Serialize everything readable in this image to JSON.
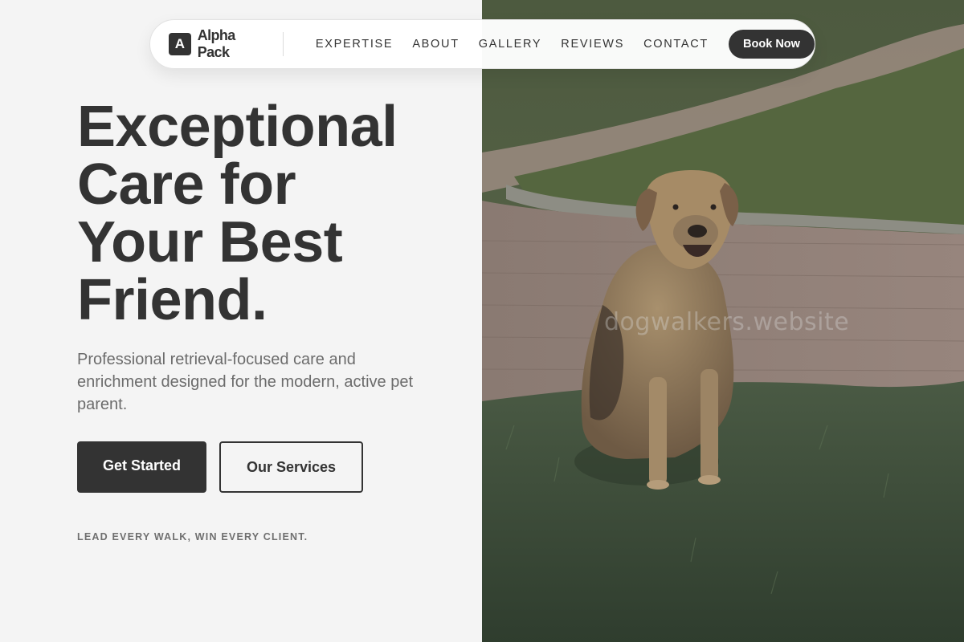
{
  "brand": {
    "mark": "A",
    "name": "Alpha Pack"
  },
  "nav": {
    "links": [
      "EXPERTISE",
      "ABOUT",
      "GALLERY",
      "REVIEWS",
      "CONTACT"
    ],
    "cta_label": "Book Now"
  },
  "hero": {
    "title_lines": [
      "Exceptional",
      "Care for",
      "Your Best",
      "Friend."
    ],
    "subtitle": "Professional retrieval-focused care and enrichment designed for the modern, active pet parent.",
    "primary_label": "Get Started",
    "secondary_label": "Our Services",
    "tagline": "LEAD EVERY WALK, WIN EVERY CLIENT."
  },
  "photo": {
    "watermark": "dogwalkers.website"
  },
  "colors": {
    "accent": "#333333",
    "background": "#f4f4f4",
    "muted_text": "#6c6c6c"
  }
}
